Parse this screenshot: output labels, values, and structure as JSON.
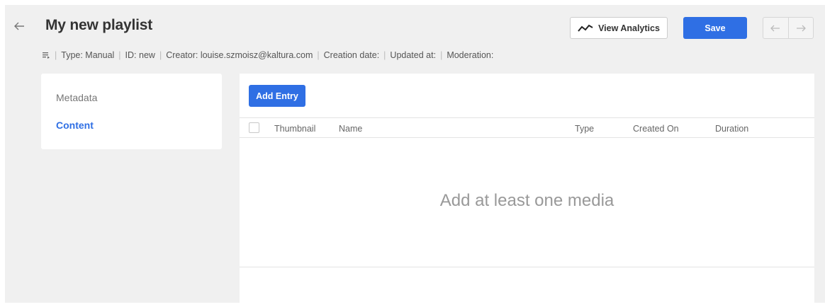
{
  "header": {
    "title": "My new playlist",
    "analytics_label": "View Analytics",
    "save_label": "Save"
  },
  "meta": {
    "type": "Type: Manual",
    "id": "ID: new",
    "creator": "Creator: louise.szmoisz@kaltura.com",
    "creation_date": "Creation date:",
    "updated_at": "Updated at:",
    "moderation": "Moderation:"
  },
  "sidebar": {
    "items": [
      {
        "label": "Metadata"
      },
      {
        "label": "Content"
      }
    ]
  },
  "content": {
    "add_entry_label": "Add Entry",
    "columns": [
      "Thumbnail",
      "Name",
      "Type",
      "Created On",
      "Duration"
    ],
    "empty_message": "Add at least one media"
  },
  "colors": {
    "accent": "#2f6fe4",
    "background": "#f0f0f0"
  },
  "icons": {
    "back": "arrow-left-icon",
    "analytics": "trend-line-icon",
    "playlist": "playlist-icon",
    "prev": "arrow-left-icon",
    "next": "arrow-right-icon"
  }
}
